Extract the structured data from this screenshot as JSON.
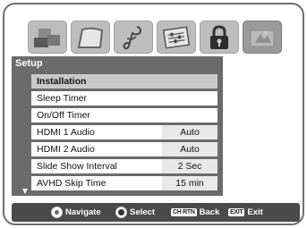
{
  "icons": [
    {
      "name": "picture-icon"
    },
    {
      "name": "sound-icon"
    },
    {
      "name": "music-note-icon"
    },
    {
      "name": "preferences-icon"
    },
    {
      "name": "lock-icon"
    },
    {
      "name": "setup-icon",
      "active": true
    }
  ],
  "panel": {
    "title": "Setup",
    "items": [
      {
        "label": "Installation",
        "selected": true
      },
      {
        "label": "Sleep Timer"
      },
      {
        "label": "On/Off Timer"
      },
      {
        "label": "HDMI 1 Audio",
        "value": "Auto"
      },
      {
        "label": "HDMI 2 Audio",
        "value": "Auto"
      },
      {
        "label": "Slide Show Interval",
        "value": "2 Sec"
      },
      {
        "label": "AVHD Skip Time",
        "value": "15 min"
      }
    ]
  },
  "footer": {
    "navigate": "Navigate",
    "select": "Select",
    "ch_rtn_key": "CH RTN",
    "back": "Back",
    "exit_key": "EXIT",
    "exit": "Exit"
  }
}
